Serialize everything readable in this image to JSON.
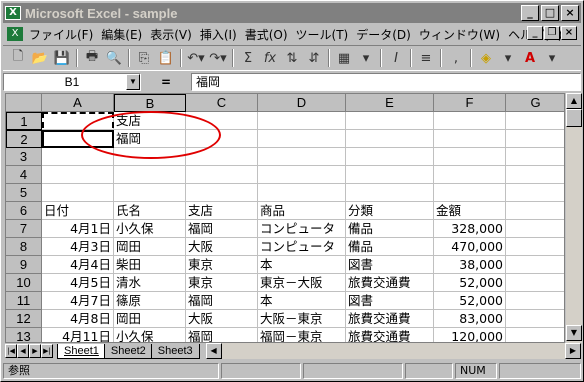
{
  "window": {
    "title": "Microsoft Excel - sample",
    "min": "_",
    "max": "□",
    "close": "×"
  },
  "menu": [
    "ファイル(F)",
    "編集(E)",
    "表示(V)",
    "挿入(I)",
    "書式(O)",
    "ツール(T)",
    "データ(D)",
    "ウィンドウ(W)",
    "ヘルプ(H)"
  ],
  "formula": {
    "cell_ref": "B1",
    "eq": "=",
    "value": "福岡"
  },
  "columns": [
    "A",
    "B",
    "C",
    "D",
    "E",
    "F",
    "G"
  ],
  "rows": [
    {
      "n": "1",
      "cells": [
        "",
        "支店",
        "",
        "",
        "",
        "",
        ""
      ]
    },
    {
      "n": "2",
      "cells": [
        "",
        "福岡",
        "",
        "",
        "",
        "",
        ""
      ]
    },
    {
      "n": "3",
      "cells": [
        "",
        "",
        "",
        "",
        "",
        "",
        ""
      ]
    },
    {
      "n": "4",
      "cells": [
        "",
        "",
        "",
        "",
        "",
        "",
        ""
      ]
    },
    {
      "n": "5",
      "cells": [
        "",
        "",
        "",
        "",
        "",
        "",
        ""
      ]
    },
    {
      "n": "6",
      "cells": [
        "日付",
        "氏名",
        "支店",
        "商品",
        "分類",
        "金額",
        ""
      ]
    },
    {
      "n": "7",
      "cells": [
        "4月1日",
        "小久保",
        "福岡",
        "コンピュータ",
        "備品",
        "328,000",
        ""
      ]
    },
    {
      "n": "8",
      "cells": [
        "4月3日",
        "岡田",
        "大阪",
        "コンピュータ",
        "備品",
        "470,000",
        ""
      ]
    },
    {
      "n": "9",
      "cells": [
        "4月4日",
        "柴田",
        "東京",
        "本",
        "図書",
        "38,000",
        ""
      ]
    },
    {
      "n": "10",
      "cells": [
        "4月5日",
        "清水",
        "東京",
        "東京－大阪",
        "旅費交通費",
        "52,000",
        ""
      ]
    },
    {
      "n": "11",
      "cells": [
        "4月7日",
        "篠原",
        "福岡",
        "本",
        "図書",
        "52,000",
        ""
      ]
    },
    {
      "n": "12",
      "cells": [
        "4月8日",
        "岡田",
        "大阪",
        "大阪－東京",
        "旅費交通費",
        "83,000",
        ""
      ]
    },
    {
      "n": "13",
      "cells": [
        "4月11日",
        "小久保",
        "福岡",
        "福岡－東京",
        "旅費交通費",
        "120,000",
        ""
      ]
    }
  ],
  "tabs": [
    "Sheet1",
    "Sheet2",
    "Sheet3"
  ],
  "status": {
    "mode": "参照",
    "num": "NUM"
  }
}
